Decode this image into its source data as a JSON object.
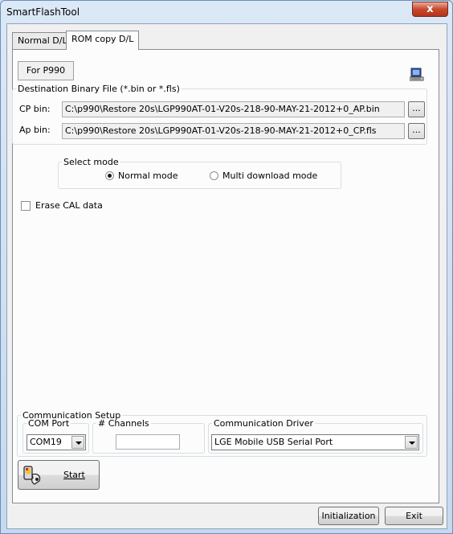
{
  "window": {
    "title": "SmartFlashTool",
    "close_symbol": "x"
  },
  "tabs": [
    {
      "label": "Normal D/L",
      "active": false
    },
    {
      "label": "ROM copy D/L",
      "active": true
    }
  ],
  "device_label": "For P990",
  "destination": {
    "legend": "Destination Binary File (*.bin or *.fls)",
    "cp_label": "CP bin:",
    "cp_path": "C:\\p990\\Restore 20s\\LGP990AT-01-V20s-218-90-MAY-21-2012+0_AP.bin",
    "ap_label": "Ap bin:",
    "ap_path": "C:\\p990\\Restore 20s\\LGP990AT-01-V20s-218-90-MAY-21-2012+0_CP.fls",
    "browse_label": "..."
  },
  "select_mode": {
    "legend": "Select mode",
    "options": [
      {
        "label": "Normal mode",
        "checked": true
      },
      {
        "label": "Multi download mode",
        "checked": false
      }
    ]
  },
  "erase_cal": {
    "label": "Erase CAL data",
    "checked": false
  },
  "communication": {
    "legend": "Communication Setup",
    "com_port_legend": "COM Port",
    "com_port_value": "COM19",
    "channels_legend": "# Channels",
    "channels_value": "",
    "driver_legend": "Communication Driver",
    "driver_value": "LGE Mobile USB Serial Port"
  },
  "start_button": {
    "label": "Start",
    "icon": "flash-phone-icon"
  },
  "footer": {
    "initialization_label": "Initialization",
    "exit_label": "Exit"
  },
  "colors": {
    "title_bar": "#c5d9ef",
    "close_button": "#c7492e",
    "panel": "#fcfcfc",
    "dialog_bg": "#f0f0f0"
  }
}
